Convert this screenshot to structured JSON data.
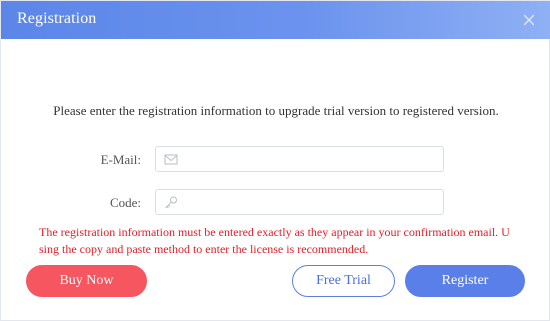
{
  "dialog": {
    "title": "Registration",
    "close_icon": "close-icon"
  },
  "instruction": "Please enter the registration information to upgrade trial version to registered version.",
  "form": {
    "email": {
      "label": "E-Mail:",
      "icon": "envelope-icon",
      "value": "",
      "placeholder": ""
    },
    "code": {
      "label": "Code:",
      "icon": "key-icon",
      "value": "",
      "placeholder": ""
    }
  },
  "warning": "The registration information must be entered exactly as they appear in your confirmation email. Using the copy and paste method to enter the license is recommended.",
  "buttons": {
    "buy_now": "Buy Now",
    "free_trial": "Free Trial",
    "register": "Register"
  },
  "colors": {
    "title_gradient_start": "#5b86e8",
    "title_gradient_end": "#8fb0f4",
    "warning_text": "#e0202c",
    "buy_button": "#f5565f",
    "register_button": "#5b7fe8",
    "trial_border": "#5b7fe0"
  }
}
